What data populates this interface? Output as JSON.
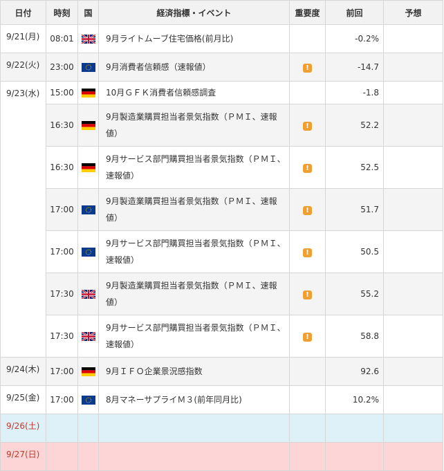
{
  "headers": {
    "date": "日付",
    "time": "時刻",
    "country": "国",
    "event": "経済指標・イベント",
    "importance": "重要度",
    "previous": "前回",
    "forecast": "予想"
  },
  "importance_mark": "!",
  "rows": [
    {
      "date": "9/21(月)",
      "time": "08:01",
      "country": "uk-flag-icon",
      "event": "9月ライトムーブ住宅価格(前月比)",
      "important": false,
      "previous": "-0.2%"
    },
    {
      "date": "9/22(火)",
      "time": "23:00",
      "country": "eu-flag-icon",
      "event": "9月消費者信頼感（速報値）",
      "important": true,
      "previous": "-14.7"
    },
    {
      "date": "9/23(水)",
      "time": "15:00",
      "country": "de-flag-icon",
      "event": "10月ＧＦＫ消費者信頼感調査",
      "important": false,
      "previous": "-1.8"
    },
    {
      "date": "",
      "time": "16:30",
      "country": "de-flag-icon",
      "event_line1": "9月製造業購買担当者景気指数（ＰＭＩ、速報",
      "event_line2": "値）",
      "important": true,
      "previous": "52.2"
    },
    {
      "date": "",
      "time": "16:30",
      "country": "de-flag-icon",
      "event_line1": "9月サービス部門購買担当者景気指数（ＰＭＩ、",
      "event_line2": "速報値）",
      "important": true,
      "previous": "52.5"
    },
    {
      "date": "",
      "time": "17:00",
      "country": "eu-flag-icon",
      "event_line1": "9月製造業購買担当者景気指数（ＰＭＩ、速報",
      "event_line2": "値）",
      "important": true,
      "previous": "51.7"
    },
    {
      "date": "",
      "time": "17:00",
      "country": "eu-flag-icon",
      "event_line1": "9月サービス部門購買担当者景気指数（ＰＭＩ、",
      "event_line2": "速報値）",
      "important": true,
      "previous": "50.5"
    },
    {
      "date": "",
      "time": "17:30",
      "country": "uk-flag-icon",
      "event_line1": "9月製造業購買担当者景気指数（ＰＭＩ、速報",
      "event_line2": "値）",
      "important": true,
      "previous": "55.2"
    },
    {
      "date": "",
      "time": "17:30",
      "country": "uk-flag-icon",
      "event_line1": "9月サービス部門購買担当者景気指数（ＰＭＩ、",
      "event_line2": "速報値）",
      "important": true,
      "previous": "58.8"
    },
    {
      "date": "9/24(木)",
      "time": "17:00",
      "country": "de-flag-icon",
      "event": "9月ＩＦＯ企業景況感指数",
      "important": false,
      "previous": "92.6"
    },
    {
      "date": "9/25(金)",
      "time": "17:00",
      "country": "eu-flag-icon",
      "event": "8月マネーサプライＭ３(前年同月比)",
      "important": false,
      "previous": "10.2%"
    },
    {
      "date": "9/26(土)"
    },
    {
      "date": "9/27(日)"
    }
  ]
}
